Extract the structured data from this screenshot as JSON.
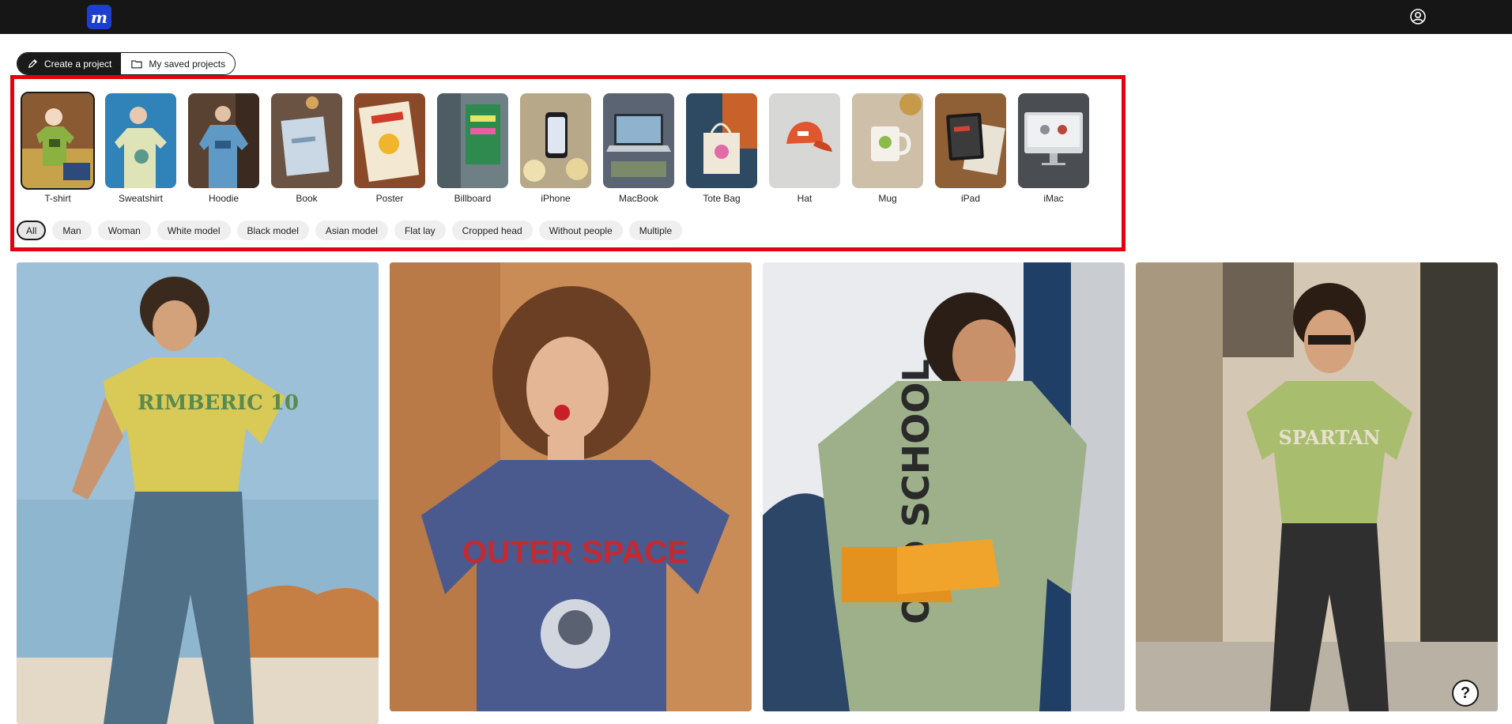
{
  "app": {
    "logo_letter": "m",
    "brand_color": "#1c3fcf"
  },
  "header": {
    "account_icon": "user-circle-icon"
  },
  "tabs": [
    {
      "label": "Create a project",
      "icon": "pencil-icon",
      "active": true
    },
    {
      "label": "My saved projects",
      "icon": "folder-icon",
      "active": false
    }
  ],
  "categories": [
    {
      "label": "T-shirt",
      "selected": true
    },
    {
      "label": "Sweatshirt"
    },
    {
      "label": "Hoodie"
    },
    {
      "label": "Book"
    },
    {
      "label": "Poster"
    },
    {
      "label": "Billboard"
    },
    {
      "label": "iPhone"
    },
    {
      "label": "MacBook"
    },
    {
      "label": "Tote Bag"
    },
    {
      "label": "Hat"
    },
    {
      "label": "Mug"
    },
    {
      "label": "iPad"
    },
    {
      "label": "iMac"
    }
  ],
  "filters": [
    "All",
    "Man",
    "Woman",
    "White model",
    "Black model",
    "Asian model",
    "Flat lay",
    "Cropped head",
    "Without people",
    "Multiple"
  ],
  "active_filter": "All",
  "highlight_color": "#e3000f",
  "gallery": [
    {
      "name": "mockup-yellow-tshirt-man-beach",
      "shirt_text": "RIMBERIC 10"
    },
    {
      "name": "mockup-navy-tshirt-woman-strawberry",
      "shirt_text": "OUTER SPACE"
    },
    {
      "name": "mockup-sage-tshirt-man-back",
      "shirt_text": "OLD SCHOOL"
    },
    {
      "name": "mockup-green-tshirt-man-sunglasses",
      "shirt_text": "SPARTAN"
    }
  ],
  "help": {
    "label": "?"
  }
}
